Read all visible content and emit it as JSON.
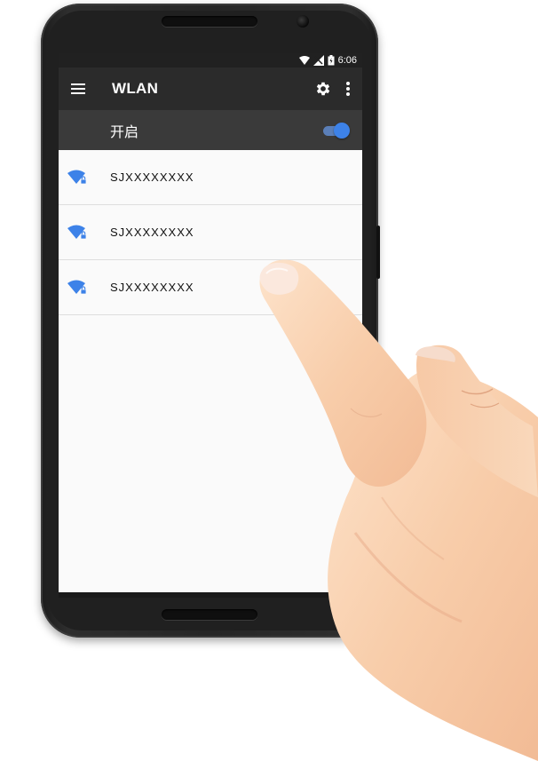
{
  "status_bar": {
    "time": "6:06"
  },
  "app_bar": {
    "title": "WLAN"
  },
  "wifi_toggle": {
    "label": "开启",
    "state": "on"
  },
  "networks": [
    {
      "name": "SJXXXXXXXX",
      "secured": true
    },
    {
      "name": "SJXXXXXXXX",
      "secured": true
    },
    {
      "name": "SJXXXXXXXX",
      "secured": true
    }
  ],
  "icons": {
    "menu": "menu-icon",
    "settings": "gear-icon",
    "more": "more-vert-icon",
    "wifi": "wifi-lock-icon",
    "signal": "signal-icon",
    "battery": "battery-icon"
  },
  "colors": {
    "accent": "#3d82e8",
    "app_bar": "#2b2b2b",
    "toggle_row": "#3a3a3a",
    "status_bar": "#212121"
  }
}
